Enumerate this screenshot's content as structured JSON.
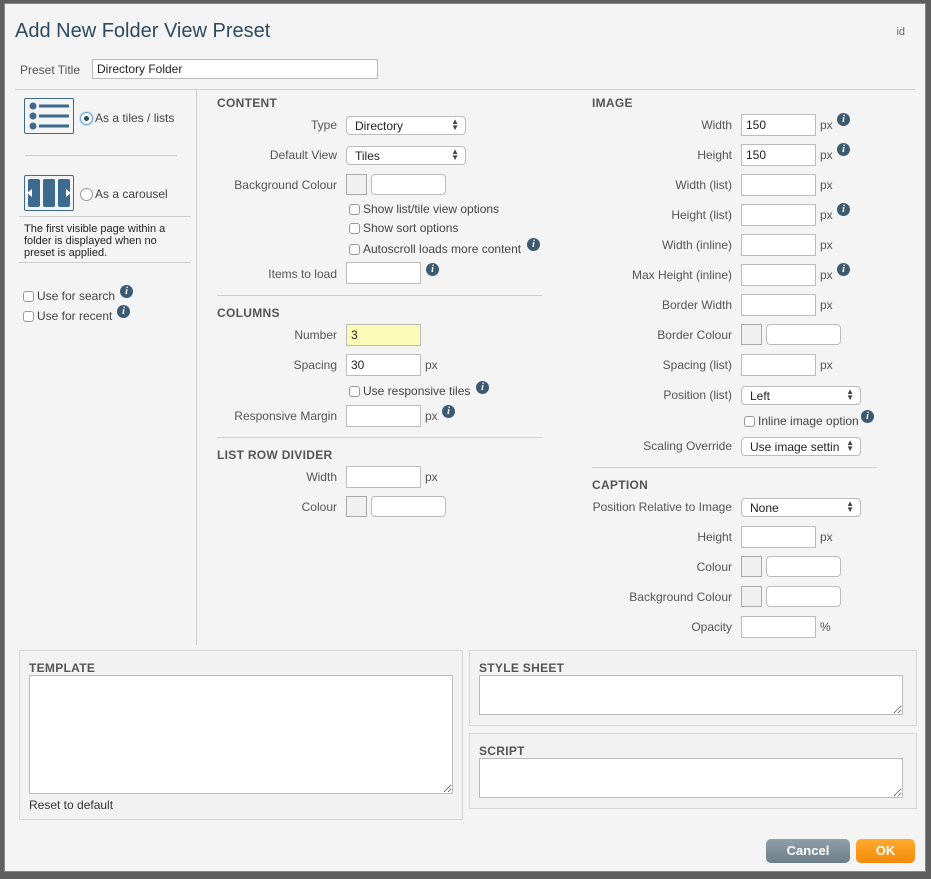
{
  "dialog": {
    "title": "Add New Folder View Preset",
    "id_label": "id",
    "preset_title_label": "Preset Title",
    "preset_title_value": "Directory Folder"
  },
  "layout_options": {
    "tiles_label": "As a tiles / lists",
    "tiles_selected": true,
    "carousel_label": "As a carousel",
    "carousel_selected": false,
    "note": "The first visible page within a folder is displayed when no preset is applied.",
    "use_for_search": "Use for search",
    "use_for_recent": "Use for recent"
  },
  "content": {
    "heading": "CONTENT",
    "type_label": "Type",
    "type_value": "Directory",
    "default_view_label": "Default View",
    "default_view_value": "Tiles",
    "bg_colour_label": "Background Colour",
    "bg_colour_value": "",
    "show_list_tile": "Show list/tile view options",
    "show_sort": "Show sort options",
    "autoscroll": "Autoscroll loads more content",
    "items_to_load_label": "Items to load",
    "items_to_load_value": ""
  },
  "columns": {
    "heading": "COLUMNS",
    "number_label": "Number",
    "number_value": "3",
    "spacing_label": "Spacing",
    "spacing_value": "30",
    "responsive_tiles": "Use responsive tiles",
    "responsive_margin_label": "Responsive Margin",
    "responsive_margin_value": ""
  },
  "list_row_divider": {
    "heading": "LIST ROW DIVIDER",
    "width_label": "Width",
    "width_value": "",
    "colour_label": "Colour",
    "colour_value": ""
  },
  "image": {
    "heading": "IMAGE",
    "width_label": "Width",
    "width_value": "150",
    "height_label": "Height",
    "height_value": "150",
    "width_list_label": "Width (list)",
    "width_list_value": "",
    "height_list_label": "Height (list)",
    "height_list_value": "",
    "width_inline_label": "Width (inline)",
    "width_inline_value": "",
    "max_height_inline_label": "Max Height (inline)",
    "max_height_inline_value": "",
    "border_width_label": "Border Width",
    "border_width_value": "",
    "border_colour_label": "Border Colour",
    "border_colour_value": "",
    "spacing_list_label": "Spacing (list)",
    "spacing_list_value": "",
    "position_list_label": "Position (list)",
    "position_list_value": "Left",
    "inline_image_option": "Inline image option",
    "scaling_override_label": "Scaling Override",
    "scaling_override_value": "Use image settin"
  },
  "caption": {
    "heading": "CAPTION",
    "position_label": "Position Relative to Image",
    "position_value": "None",
    "height_label": "Height",
    "height_value": "",
    "colour_label": "Colour",
    "colour_value": "",
    "bg_colour_label": "Background Colour",
    "bg_colour_value": "",
    "opacity_label": "Opacity",
    "opacity_value": ""
  },
  "units": {
    "px": "px",
    "percent": "%"
  },
  "info_glyph": "i",
  "template": {
    "heading": "TEMPLATE",
    "reset_label": "Reset to default",
    "value": ""
  },
  "stylesheet": {
    "heading": "STYLE SHEET",
    "value": ""
  },
  "script": {
    "heading": "SCRIPT",
    "value": ""
  },
  "buttons": {
    "cancel": "Cancel",
    "ok": "OK"
  },
  "colors": {
    "title": "#2d4a5e",
    "icon": "#3d6a8e",
    "ok": "#f68a0a",
    "cancel": "#7a8b96",
    "highlight": "#fbfbb8"
  }
}
